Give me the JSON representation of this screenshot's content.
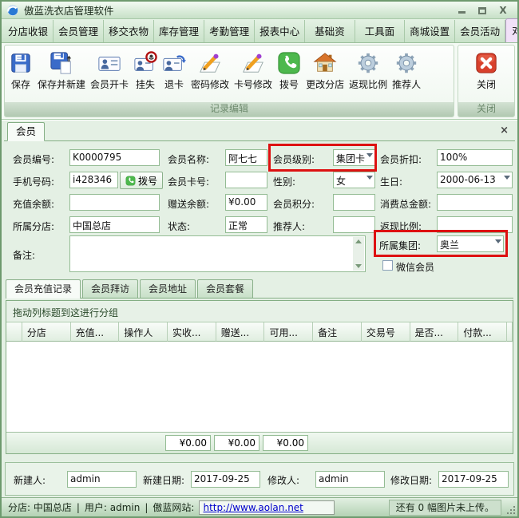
{
  "colors": {
    "highlight_red": "#dd1111",
    "link_blue": "#0000cc",
    "active_menu_tab_bg": "#f1e1f8",
    "theme_green": "#c9e2c9"
  },
  "window": {
    "title": "傲蓝洗衣店管理软件"
  },
  "menu": {
    "tabs": [
      "分店收银",
      "会员管理",
      "移交衣物",
      "库存管理",
      "考勤管理",
      "报表中心",
      "基础资",
      "工具面",
      "商城设置",
      "会员活动",
      "对象管理"
    ],
    "active_tab": "对象管理"
  },
  "toolbar": {
    "buttons": [
      {
        "label": "保存",
        "icon": "floppy-icon"
      },
      {
        "label": "保存并新建",
        "icon": "floppy-new-icon"
      },
      {
        "label": "会员开卡",
        "icon": "member-card-icon"
      },
      {
        "label": "挂失",
        "icon": "card-loss-icon"
      },
      {
        "label": "退卡",
        "icon": "card-return-icon"
      },
      {
        "label": "密码修改",
        "icon": "pencil-icon"
      },
      {
        "label": "卡号修改",
        "icon": "pencil-icon"
      },
      {
        "label": "拨号",
        "icon": "phone-icon"
      },
      {
        "label": "更改分店",
        "icon": "house-icon"
      },
      {
        "label": "返现比例",
        "icon": "gear-icon"
      },
      {
        "label": "推荐人",
        "icon": "gear-icon"
      }
    ],
    "close_button": {
      "label": "关闭",
      "icon": "close-x-icon"
    },
    "group_labels": {
      "edit": "记录编辑",
      "close": "关闭"
    }
  },
  "doc_tab": {
    "label": "会员",
    "close": "×"
  },
  "form": {
    "member_no": {
      "label": "会员编号:",
      "value": "K0000795"
    },
    "member_name": {
      "label": "会员名称:",
      "value": "阿七七"
    },
    "member_level": {
      "label": "会员级别:",
      "value": "集团卡"
    },
    "member_discount": {
      "label": "会员折扣:",
      "value": "100%"
    },
    "phone": {
      "label": "手机号码:",
      "value": "i428346",
      "dial_label": "拨号"
    },
    "card_no": {
      "label": "会员卡号:",
      "value": ""
    },
    "gender": {
      "label": "性别:",
      "value": "女"
    },
    "birthday": {
      "label": "生日:",
      "value": "2000-06-13"
    },
    "recharge_balance": {
      "label": "充值余额:",
      "value": ""
    },
    "gift_balance": {
      "label": "赠送余额:",
      "value": "¥0.00"
    },
    "points": {
      "label": "会员积分:",
      "value": ""
    },
    "total_consumption": {
      "label": "消费总金额:",
      "value": ""
    },
    "branch": {
      "label": "所属分店:",
      "value": "中国总店"
    },
    "status": {
      "label": "状态:",
      "value": "正常"
    },
    "referrer": {
      "label": "推荐人:",
      "value": ""
    },
    "cashback_ratio": {
      "label": "返现比例:",
      "value": ""
    },
    "remark": {
      "label": "备注:",
      "value": ""
    },
    "group": {
      "label": "所属集团:",
      "value": "奥兰"
    },
    "wechat_member": {
      "label": "微信会员",
      "checked": false
    }
  },
  "subtabs": [
    "会员充值记录",
    "会员拜访",
    "会员地址",
    "会员套餐"
  ],
  "grid": {
    "group_hint": "拖动列标题到这进行分组",
    "columns": [
      "分店",
      "充值...",
      "操作人",
      "实收...",
      "赠送...",
      "可用...",
      "备注",
      "交易号",
      "是否...",
      "付款..."
    ],
    "rows": [],
    "summary": [
      "¥0.00",
      "¥0.00",
      "¥0.00"
    ]
  },
  "audit": {
    "created_by": {
      "label": "新建人:",
      "value": "admin"
    },
    "created_date": {
      "label": "新建日期:",
      "value": "2017-09-25"
    },
    "modified_by": {
      "label": "修改人:",
      "value": "admin"
    },
    "modified_date": {
      "label": "修改日期:",
      "value": "2017-09-25"
    }
  },
  "statusbar": {
    "branch": "分店: 中国总店",
    "sep1": "|",
    "user": "用户: admin",
    "sep2": "|",
    "website_label": "傲蓝网站:",
    "website_url": "http://www.aolan.net",
    "upload_info": "还有 0 幅图片未上传。"
  }
}
